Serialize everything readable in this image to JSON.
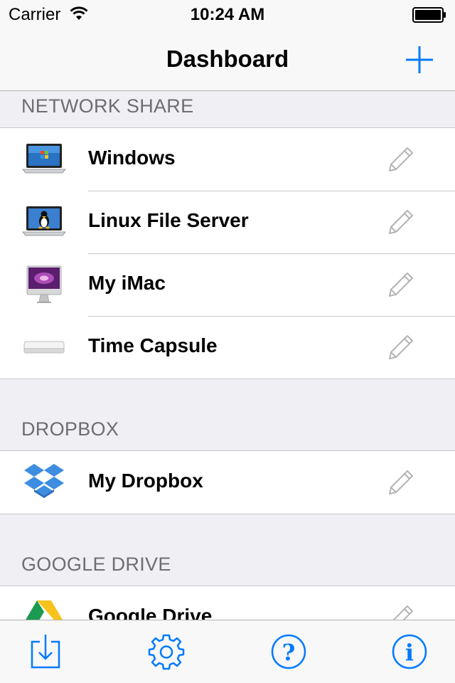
{
  "status_bar": {
    "carrier": "Carrier",
    "time": "10:24 AM"
  },
  "nav": {
    "title": "Dashboard"
  },
  "sections": {
    "network": {
      "header": "NETWORK SHARE",
      "items": [
        {
          "label": "Windows",
          "icon": "windows-laptop-icon"
        },
        {
          "label": "Linux File Server",
          "icon": "linux-laptop-icon"
        },
        {
          "label": "My iMac",
          "icon": "imac-icon"
        },
        {
          "label": "Time Capsule",
          "icon": "time-capsule-icon"
        }
      ]
    },
    "dropbox": {
      "header": "DROPBOX",
      "items": [
        {
          "label": "My Dropbox",
          "icon": "dropbox-icon"
        }
      ]
    },
    "gdrive": {
      "header": "GOOGLE DRIVE",
      "items": [
        {
          "label": "Google Drive",
          "icon": "google-drive-icon"
        }
      ]
    }
  },
  "tab_bar": {
    "items": [
      {
        "icon": "download-icon"
      },
      {
        "icon": "settings-gear-icon"
      },
      {
        "icon": "help-icon"
      },
      {
        "icon": "info-icon"
      }
    ]
  },
  "colors": {
    "accent": "#007aff",
    "section_bg": "#efeff4",
    "header_text": "#6d6d72",
    "pencil": "#b4b4b4"
  }
}
